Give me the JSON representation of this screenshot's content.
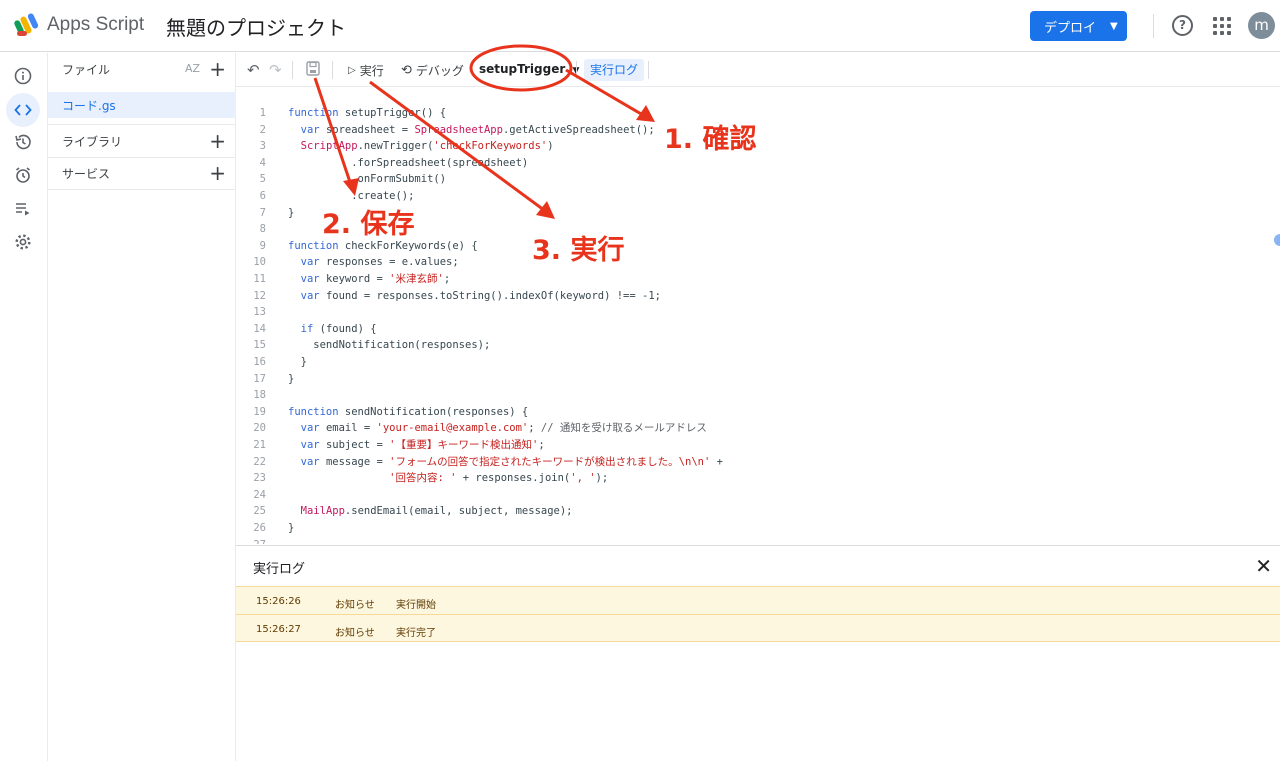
{
  "header": {
    "app_name": "Apps Script",
    "project_title": "無題のプロジェクト",
    "deploy_label": "デプロイ",
    "avatar_letter": "m",
    "help_symbol": "?"
  },
  "sidebar": {
    "files_label": "ファイル",
    "sort_label": "AZ",
    "file_name": "コード.gs",
    "libraries_label": "ライブラリ",
    "services_label": "サービス"
  },
  "toolbar": {
    "run_label": "実行",
    "debug_label": "デバッグ",
    "function_name": "setupTrigger",
    "execution_log_label": "実行ログ"
  },
  "annotations": {
    "confirm": "1. 確認",
    "save": "2. 保存",
    "run": "3. 実行",
    "color": "#e8341c"
  },
  "code_lines": [
    {
      "n": "1",
      "html": "<span class=\"kw\">function</span> setupTrigger() {"
    },
    {
      "n": "2",
      "html": "  <span class=\"kw\">var</span> spreadsheet = <span class=\"cls\">SpreadsheetApp</span>.getActiveSpreadsheet();"
    },
    {
      "n": "3",
      "html": "  <span class=\"cls\">ScriptApp</span>.newTrigger(<span class=\"str\">'checkForKeywords'</span>)"
    },
    {
      "n": "4",
      "html": "          .forSpreadsheet(spreadsheet)"
    },
    {
      "n": "5",
      "html": "          .onFormSubmit()"
    },
    {
      "n": "6",
      "html": "          .create();"
    },
    {
      "n": "7",
      "html": "}"
    },
    {
      "n": "8",
      "html": ""
    },
    {
      "n": "9",
      "html": "<span class=\"kw\">function</span> checkForKeywords(e) {"
    },
    {
      "n": "10",
      "html": "  <span class=\"kw\">var</span> responses = e.values;"
    },
    {
      "n": "11",
      "html": "  <span class=\"kw\">var</span> keyword = <span class=\"str\">'米津玄師'</span>;"
    },
    {
      "n": "12",
      "html": "  <span class=\"kw\">var</span> found = responses.toString().indexOf(keyword) !== -1;"
    },
    {
      "n": "13",
      "html": ""
    },
    {
      "n": "14",
      "html": "  <span class=\"kw\">if</span> (found) {"
    },
    {
      "n": "15",
      "html": "    sendNotification(responses);"
    },
    {
      "n": "16",
      "html": "  }"
    },
    {
      "n": "17",
      "html": "}"
    },
    {
      "n": "18",
      "html": ""
    },
    {
      "n": "19",
      "html": "<span class=\"kw\">function</span> sendNotification(responses) {"
    },
    {
      "n": "20",
      "html": "  <span class=\"kw\">var</span> email = <span class=\"str\">'your-email@example.com'</span>; <span class=\"cmt\">// 通知を受け取るメールアドレス</span>"
    },
    {
      "n": "21",
      "html": "  <span class=\"kw\">var</span> subject = <span class=\"str\">'【重要】キーワード検出通知'</span>;"
    },
    {
      "n": "22",
      "html": "  <span class=\"kw\">var</span> message = <span class=\"str\">'フォームの回答で指定されたキーワードが検出されました。\\n\\n'</span> +"
    },
    {
      "n": "23",
      "html": "                <span class=\"str\">'回答内容: '</span> + responses.join(<span class=\"str\">', '</span>);"
    },
    {
      "n": "24",
      "html": ""
    },
    {
      "n": "25",
      "html": "  <span class=\"cls\">MailApp</span>.sendEmail(email, subject, message);"
    },
    {
      "n": "26",
      "html": "}"
    },
    {
      "n": "27",
      "html": ""
    }
  ],
  "log": {
    "title": "実行ログ",
    "close_symbol": "✕",
    "rows": [
      {
        "time": "15:26:26",
        "level": "お知らせ",
        "message": "実行開始"
      },
      {
        "time": "15:26:27",
        "level": "お知らせ",
        "message": "実行完了"
      }
    ]
  }
}
